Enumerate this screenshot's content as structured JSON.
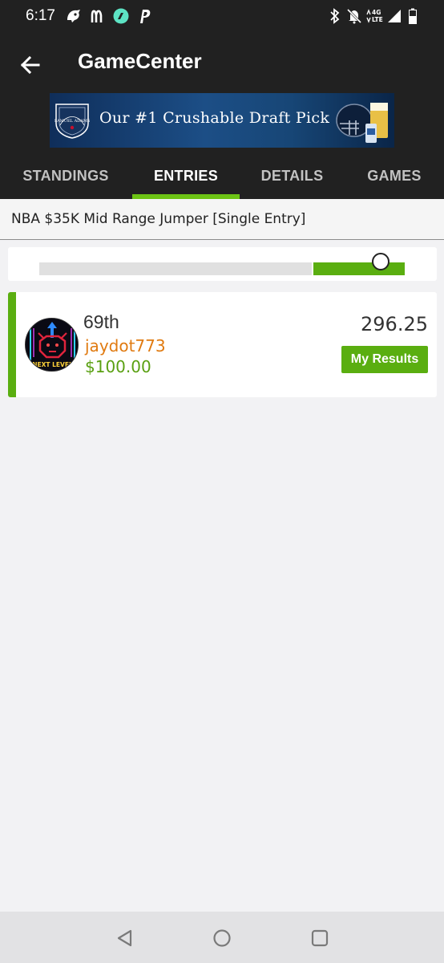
{
  "status_bar": {
    "time": "6:17",
    "network": "4G LTE",
    "icons": [
      "app-icon",
      "mcdonalds-icon",
      "robinhood-icon",
      "paypal-icon",
      "bluetooth-icon",
      "mute-icon",
      "signal-icon",
      "battery-icon"
    ]
  },
  "header": {
    "title": "GameCenter",
    "back_icon": "back-arrow-icon"
  },
  "ad": {
    "text": "Our #1 Crushable Draft Pick",
    "brand": "SAMUEL ADAMS"
  },
  "tabs": [
    {
      "label": "STANDINGS",
      "active": false
    },
    {
      "label": "ENTRIES",
      "active": true
    },
    {
      "label": "DETAILS",
      "active": false
    },
    {
      "label": "GAMES",
      "active": false
    }
  ],
  "contest": {
    "title": "NBA $35K Mid Range Jumper [Single Entry]"
  },
  "progress": {
    "position_fraction": 0.87
  },
  "entry": {
    "rank": "69th",
    "username": "jaydot773",
    "prize": "$100.00",
    "score": "296.25",
    "results_button": "My Results",
    "avatar_text": "NEXT LEVEL"
  },
  "colors": {
    "app_bar": "#212121",
    "accent_green": "#5aae10",
    "tab_underline": "#6cc314",
    "username": "#e07a10",
    "background": "#f2f2f4"
  },
  "nav": {
    "icons": [
      "back-triangle-icon",
      "home-circle-icon",
      "recents-square-icon"
    ]
  }
}
